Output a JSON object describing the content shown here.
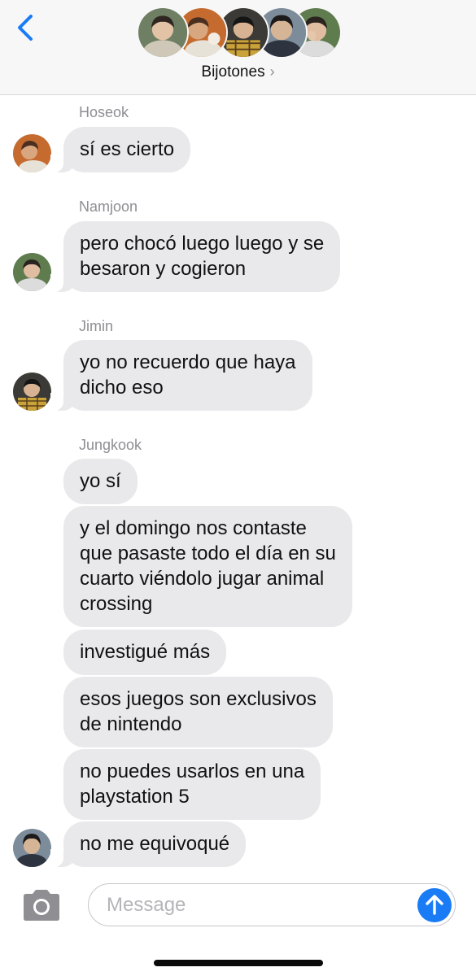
{
  "header": {
    "back_icon": "chevron-left-icon",
    "group_name": "Bijotones",
    "group_chevron": "›",
    "accent_color": "#1a7cf5"
  },
  "messages": [
    {
      "sender": "Hoseok",
      "lines": [
        "sí es cierto"
      ]
    },
    {
      "sender": "Namjoon",
      "lines": [
        "pero chocó luego luego y se",
        "besaron y cogieron"
      ]
    },
    {
      "sender": "Jimin",
      "lines": [
        "yo no recuerdo que haya",
        "dicho eso"
      ]
    },
    {
      "sender": "Jungkook",
      "lines": [
        "yo sí"
      ]
    },
    {
      "lines": [
        "y el domingo nos contaste",
        "que pasaste todo el día en su",
        "cuarto viéndolo jugar animal",
        "crossing"
      ]
    },
    {
      "lines": [
        "investigué más"
      ]
    },
    {
      "lines": [
        "esos juegos son exclusivos",
        "de nintendo"
      ]
    },
    {
      "lines": [
        "no puedes usarlos en una",
        "playstation 5"
      ]
    },
    {
      "lines": [
        "no me equivoqué"
      ]
    }
  ],
  "input": {
    "placeholder": "Message",
    "camera_icon": "camera-icon",
    "send_icon": "send-arrow-icon"
  },
  "colors": {
    "bubble": "#e9e9eb",
    "header_bg": "#f7f7f7",
    "secondary_text": "#8e8e93"
  }
}
